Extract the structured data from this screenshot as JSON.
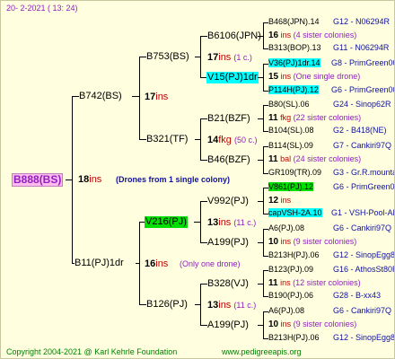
{
  "header": {
    "date": "20-  2-2021  ( 13: 24)"
  },
  "root": {
    "name": "B888(BS)",
    "count": "18",
    "ins": "ins",
    "note": "(Drones from 1 single colony)"
  },
  "l1": {
    "a": {
      "name": "B742(BS)",
      "count": "17",
      "ins": "ins"
    },
    "b": {
      "name": "B11(PJ)1dr",
      "count": "16",
      "ins": "ins",
      "note": "(Only one drone)"
    }
  },
  "l2": {
    "a": {
      "name": "B753(BS)",
      "count": "17",
      "ins": "ins",
      "note": "(1 c.)"
    },
    "b": {
      "name": "B321(TF)",
      "count": "14",
      "ins": "fkg",
      "note": "(50 c.)"
    },
    "c": {
      "name": "V216(PJ)",
      "count": "13",
      "ins": "ins",
      "note": "(11 c.)"
    },
    "d": {
      "name": "B126(PJ)",
      "count": "13",
      "ins": "ins",
      "note": "(11 c.)"
    }
  },
  "l3": [
    {
      "name": "B6106(JPN)",
      "count": "17",
      "ins": "ins",
      "note": "(1 c.)"
    },
    {
      "name": "V15(PJ)1dr",
      "count": "15",
      "ins": "ins",
      "note": "(One single drone)"
    },
    {
      "name": "B21(BZF)",
      "count": "11",
      "ins": "fkg",
      "note": "(22 sister colonies)"
    },
    {
      "name": "B46(BZF)",
      "count": "11",
      "ins": "bal",
      "note": "(24 sister colonies)"
    },
    {
      "name": "V992(PJ)",
      "count": "12",
      "ins": "ins",
      "note": ""
    },
    {
      "name": "A199(PJ)",
      "count": "10",
      "ins": "ins",
      "note": "(9 sister colonies)"
    },
    {
      "name": "B328(VJ)",
      "count": "11",
      "ins": "ins",
      "note": "(12 sister colonies)"
    },
    {
      "name": "A199(PJ)",
      "count": "10",
      "ins": "ins",
      "note": "(9 sister colonies)"
    }
  ],
  "r": [
    {
      "left": "B468(JPN).14",
      "right": "G12 - N06294R"
    },
    {
      "count": "16",
      "ins": "ins",
      "note": "(4 sister colonies)"
    },
    {
      "left": "B313(BOP).13",
      "right": "G11 - N06294R"
    },
    {
      "left": "V36(PJ)1dr.14",
      "right": "G8 - PrimGreen00"
    },
    {
      "count": "15",
      "ins": "ins",
      "note": "(One single drone)"
    },
    {
      "left": "P114H(PJ).12",
      "right": "G6 - PrimGreen00"
    },
    {
      "left": "B80(SL).06",
      "right": "G24 - Sinop62R"
    },
    {
      "count": "11",
      "ins": "fkg",
      "note": "(22 sister colonies)"
    },
    {
      "left": "B104(SL).08",
      "right": "G2 - B418(NE)"
    },
    {
      "left": "B114(SL).09",
      "right": "G7 - Cankiri97Q"
    },
    {
      "count": "11",
      "ins": "bal",
      "note": "(24 sister colonies)"
    },
    {
      "left": "GR109(TR).09",
      "right": "G3 - Gr.R.mounta"
    },
    {
      "left": "V861(PJ).12",
      "right": "G6 - PrimGreen00"
    },
    {
      "count": "12",
      "ins": "ins",
      "note": ""
    },
    {
      "left": "capVSH-2A.10",
      "right": "G1 - VSH-Pool-AR"
    },
    {
      "left": "A6(PJ).08",
      "right": "G6 - Cankiri97Q"
    },
    {
      "count": "10",
      "ins": "ins",
      "note": "(9 sister colonies)"
    },
    {
      "left": "B213H(PJ).06",
      "right": "G12 - SinopEgg86R"
    },
    {
      "left": "B123(PJ).09",
      "right": "G16 - AthosSt80R"
    },
    {
      "count": "11",
      "ins": "ins",
      "note": "(12 sister colonies)"
    },
    {
      "left": "B190(PJ).06",
      "right": "G28 - B-xx43"
    },
    {
      "left": "A6(PJ).08",
      "right": "G6 - Cankiri97Q"
    },
    {
      "count": "10",
      "ins": "ins",
      "note": "(9 sister colonies)"
    },
    {
      "left": "B213H(PJ).06",
      "right": "G12 - SinopEgg86R"
    }
  ],
  "footer": {
    "copyright": "Copyright 2004-2021 @ Karl Kehrle Foundation",
    "url": "www.pedigreeapis.org"
  }
}
